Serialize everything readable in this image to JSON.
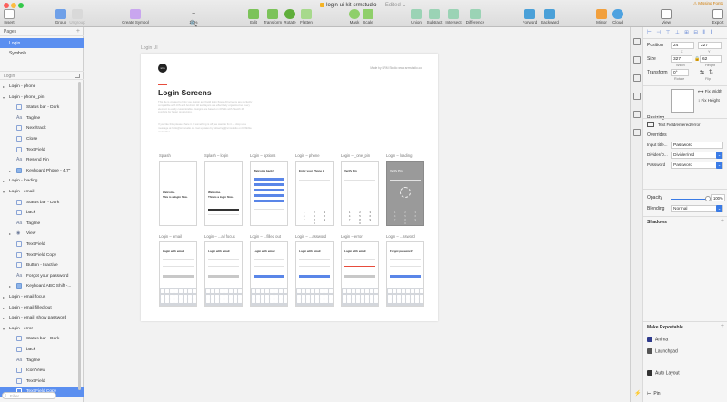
{
  "window": {
    "title": "login-ui-kit-srmstudio",
    "title_suffix": " — Edited ⌄",
    "missing_fonts": "⚠ Missing Fonts"
  },
  "toolbar": {
    "insert": "Insert",
    "group": "Group",
    "ungroup": "Ungroup",
    "create_symbol": "Create Symbol",
    "zoom": "20%",
    "edit": "Edit",
    "transform": "Transform",
    "rotate": "Rotate",
    "flatten": "Flatten",
    "mask": "Mask",
    "scale": "Scale",
    "union": "Union",
    "subtract": "Subtract",
    "intersect": "Intersect",
    "difference": "Difference",
    "forward": "Forward",
    "backward": "Backward",
    "mirror": "Mirror",
    "cloud": "Cloud",
    "view": "View",
    "export": "Export"
  },
  "pages": {
    "header": "Pages",
    "items": [
      "Login",
      "Symbols"
    ]
  },
  "layers": {
    "header": "Login",
    "filter_placeholder": "Filter",
    "items": [
      {
        "label": "Login - phone",
        "type": "artboard",
        "indent": 0
      },
      {
        "label": "Login - phone_pin",
        "type": "artboard-open",
        "indent": 0
      },
      {
        "label": "Status bar - Dark",
        "type": "symbol",
        "indent": 1
      },
      {
        "label": "Tagline",
        "type": "text",
        "indent": 1
      },
      {
        "label": "Next/track",
        "type": "symbol",
        "indent": 1
      },
      {
        "label": "Close",
        "type": "symbol",
        "indent": 1
      },
      {
        "label": "Text Field",
        "type": "symbol",
        "indent": 1
      },
      {
        "label": "Resend Pin",
        "type": "text",
        "indent": 1
      },
      {
        "label": "Keyboard Phone - 4.7\"",
        "type": "folder",
        "indent": 1
      },
      {
        "label": "Login - loading",
        "type": "artboard",
        "indent": 0
      },
      {
        "label": "Login - email",
        "type": "artboard-open",
        "indent": 0
      },
      {
        "label": "Status bar - Dark",
        "type": "symbol",
        "indent": 1
      },
      {
        "label": "back",
        "type": "symbol",
        "indent": 1
      },
      {
        "label": "Tagline",
        "type": "text",
        "indent": 1
      },
      {
        "label": "View",
        "type": "eye",
        "indent": 1
      },
      {
        "label": "Text Field",
        "type": "symbol",
        "indent": 1
      },
      {
        "label": "Text Field Copy",
        "type": "symbol",
        "indent": 1
      },
      {
        "label": "Button - Inactive",
        "type": "symbol",
        "indent": 1
      },
      {
        "label": "Forgot your password",
        "type": "text",
        "indent": 1
      },
      {
        "label": "Keyboard ABC Shift -...",
        "type": "folder",
        "indent": 1
      },
      {
        "label": "Login - email focus",
        "type": "artboard",
        "indent": 0
      },
      {
        "label": "Login - email filled out",
        "type": "artboard",
        "indent": 0
      },
      {
        "label": "Login - email_show password",
        "type": "artboard",
        "indent": 0
      },
      {
        "label": "Login - error",
        "type": "artboard-open",
        "indent": 0
      },
      {
        "label": "Status bar - Dark",
        "type": "symbol",
        "indent": 1
      },
      {
        "label": "back",
        "type": "symbol",
        "indent": 1
      },
      {
        "label": "Tagline",
        "type": "text",
        "indent": 1
      },
      {
        "label": "Icon/View",
        "type": "symbol",
        "indent": 1
      },
      {
        "label": "Text Field",
        "type": "symbol",
        "indent": 1
      },
      {
        "label": "Text Field Copy",
        "type": "symbol",
        "indent": 1,
        "selected": true
      }
    ]
  },
  "canvas": {
    "artboard_label": "Login UI",
    "made_by": "Made by SRM Studio www.srmstudio.co",
    "title": "Login Screens",
    "desc1": "This file is created to help you design and build login flows. All screens are perfectly compatible with iOS and Android. All text layers are effectively organized so every element is easily customizable. Designs are based on iOS 11 with Sketch 48 symbols for faster prototyping.",
    "desc2": "If you like this, please share it. If something is off, we want to fix it — drop us a message at hello@srmstudio.co. Get updates by following @srmstudio on Dribbble and twitter.",
    "screens_row1": [
      {
        "label": "Splash",
        "sub": "",
        "heading": "Welcome.",
        "heading2": "This is a login flow."
      },
      {
        "label": "Splash – login",
        "sub": "",
        "heading": "Welcome.",
        "heading2": "This is a login flow."
      },
      {
        "label": "Login – options",
        "sub": "",
        "heading": "Welcome back!",
        "heading2": ""
      },
      {
        "label": "Login – phone",
        "sub": "",
        "heading": "Enter your Phone #",
        "heading2": ""
      },
      {
        "label": "Login – _one_pin",
        "sub": "",
        "heading": "Verify Pin",
        "heading2": ""
      },
      {
        "label": "Login – loading",
        "sub": "",
        "heading": "Verify Pin",
        "heading2": ""
      }
    ],
    "screens_row2": [
      {
        "label": "Login – email",
        "sub": "",
        "heading": "Login with email"
      },
      {
        "label": "Login – ...ail focus",
        "sub": "",
        "heading": "Login with email"
      },
      {
        "label": "Login – ...filled out",
        "sub": "",
        "heading": "Login with email"
      },
      {
        "label": "Login – ...assword",
        "sub": "",
        "heading": "Login with email"
      },
      {
        "label": "Login – error",
        "sub": "",
        "heading": "Login with email"
      },
      {
        "label": "Login – ...ssword",
        "sub": "",
        "heading": "Forgot password?"
      }
    ],
    "pad_digits": [
      "1",
      "2",
      "3",
      "4",
      "5",
      "6",
      "7",
      "8",
      "9",
      "",
      "0",
      ""
    ]
  },
  "inspector": {
    "position_label": "Position",
    "x": "24",
    "y": "227",
    "x_label": "X",
    "y_label": "Y",
    "size_label": "Size",
    "width": "327",
    "height": "62",
    "width_label": "Width",
    "height_label": "Height",
    "transform_label": "Transform",
    "rotate": "0°",
    "rotate_label": "Rotate",
    "flip_label": "Flip",
    "resizing_label": "Resizing",
    "fix_width": "Fix Width",
    "fix_height": "Fix Height",
    "symbol_name": "Text Field/entered/error",
    "overrides_label": "Overrides",
    "input_title_label": "Input title...",
    "input_title_value": "Password",
    "divider_label": "Divider/D...",
    "divider_value": "Divider/red",
    "password_label": "Password",
    "password_value": "Password",
    "opacity_label": "Opacity",
    "opacity_value": "100%",
    "blending_label": "Blending",
    "blending_value": "Normal",
    "shadows_label": "Shadows",
    "make_exportable": "Make Exportable",
    "anima": "Anima",
    "launchpad": "Launchpad",
    "auto_layout": "Auto Layout",
    "pin": "Pin"
  },
  "colors": {
    "accent": "#5b8ff0",
    "select_blue": "#3a7be6",
    "primary_button": "#5a86e8",
    "title_red": "#e74c3c"
  }
}
